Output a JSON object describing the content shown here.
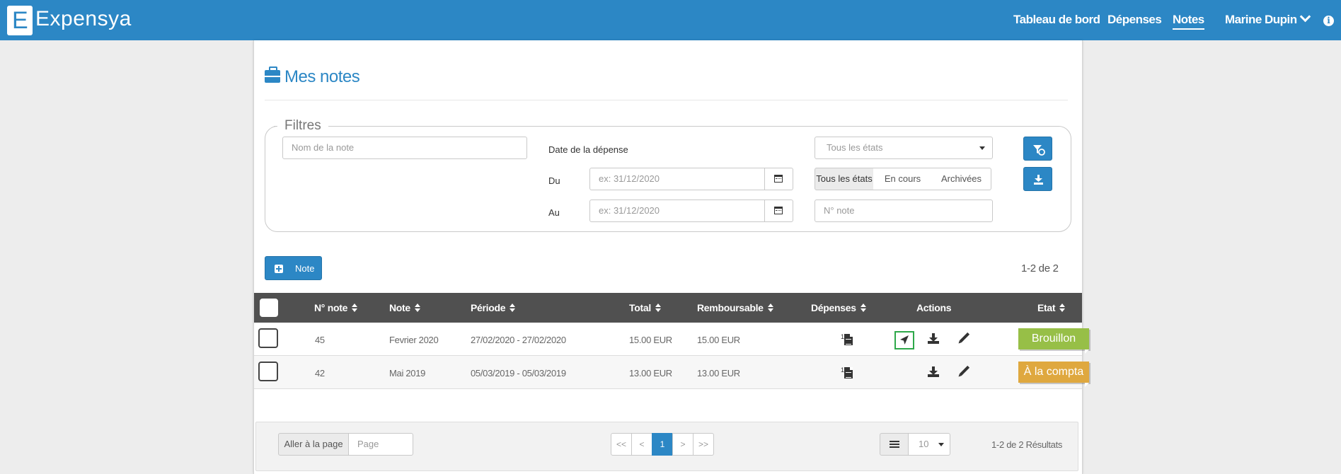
{
  "app": {
    "name": "Expensya",
    "logo_letter": "E"
  },
  "nav": {
    "items": [
      {
        "label": "Tableau de bord"
      },
      {
        "label": "Dépenses"
      },
      {
        "label": "Notes"
      }
    ],
    "user": "Marine Dupin"
  },
  "page": {
    "title": "Mes notes"
  },
  "filters": {
    "legend": "Filtres",
    "note_name_placeholder": "Nom de la note",
    "date_label": "Date de la dépense",
    "du_label": "Du",
    "au_label": "Au",
    "date_placeholder": "ex: 31/12/2020",
    "state_select": "Tous les états",
    "segments": [
      "Tous les états",
      "En cours",
      "Archivées"
    ],
    "note_number_placeholder": "N° note"
  },
  "toolbar": {
    "add_label": "Note",
    "count": "1-2 de 2"
  },
  "table": {
    "headers": {
      "num": "N° note",
      "note": "Note",
      "period": "Période",
      "total": "Total",
      "refund": "Remboursable",
      "expenses": "Dépenses",
      "actions": "Actions",
      "state": "Etat"
    },
    "rows": [
      {
        "num": "45",
        "note": "Fevrier 2020",
        "period": "27/02/2020 - 27/02/2020",
        "total": "15.00 EUR",
        "refund": "15.00 EUR",
        "expenses": "1",
        "state": "Brouillon",
        "state_color": "#97bf47"
      },
      {
        "num": "42",
        "note": "Mai 2019",
        "period": "05/03/2019 - 05/03/2019",
        "total": "13.00 EUR",
        "refund": "13.00 EUR",
        "expenses": "1",
        "state": "À la compta",
        "state_color": "#dfa83f"
      }
    ]
  },
  "footer": {
    "goto_label": "Aller à la page",
    "page_placeholder": "Page",
    "pagination": [
      "<<",
      "<",
      "1",
      ">",
      ">>"
    ],
    "page_size": "10",
    "results": "1-2 de 2 Résultats"
  },
  "colors": {
    "primary": "#2c87c5",
    "header_dark": "#505050",
    "send_highlight": "#2ea84a"
  }
}
